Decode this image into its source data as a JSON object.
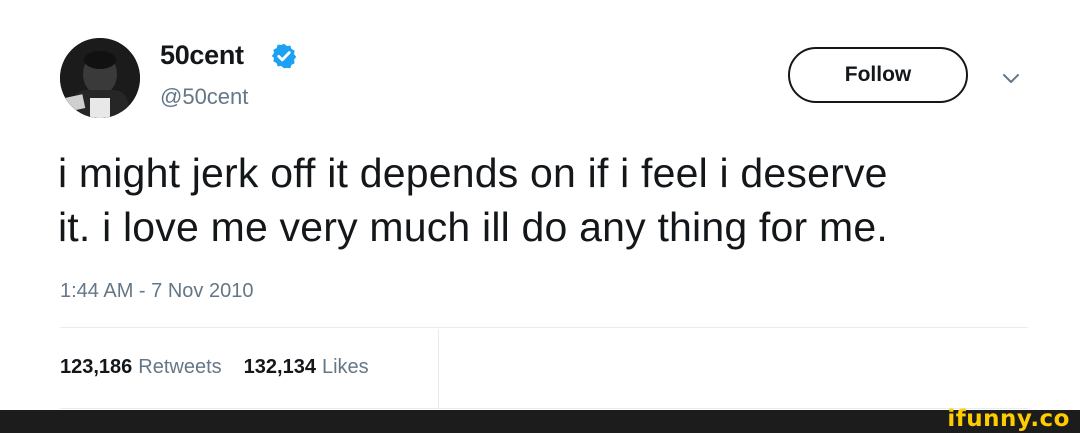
{
  "tweet": {
    "display_name": "50cent",
    "handle": "@50cent",
    "verified_icon": "verified-badge-icon",
    "follow_label": "Follow",
    "menu_icon": "chevron-down-icon",
    "text_line_1": "i might jerk off it depends on if i feel i deserve",
    "text_line_2": "it. i love me very much ill do any thing for me.",
    "timestamp": "1:44 AM - 7 Nov 2010",
    "retweets_count": "123,186",
    "retweets_label": "Retweets",
    "likes_count": "132,134",
    "likes_label": "Likes"
  },
  "watermark": {
    "logo": "ifunny.co"
  },
  "colors": {
    "verified_blue": "#1da1f2",
    "secondary_text": "#657786",
    "primary_text": "#14171a",
    "watermark_yellow": "#ffcc00"
  }
}
